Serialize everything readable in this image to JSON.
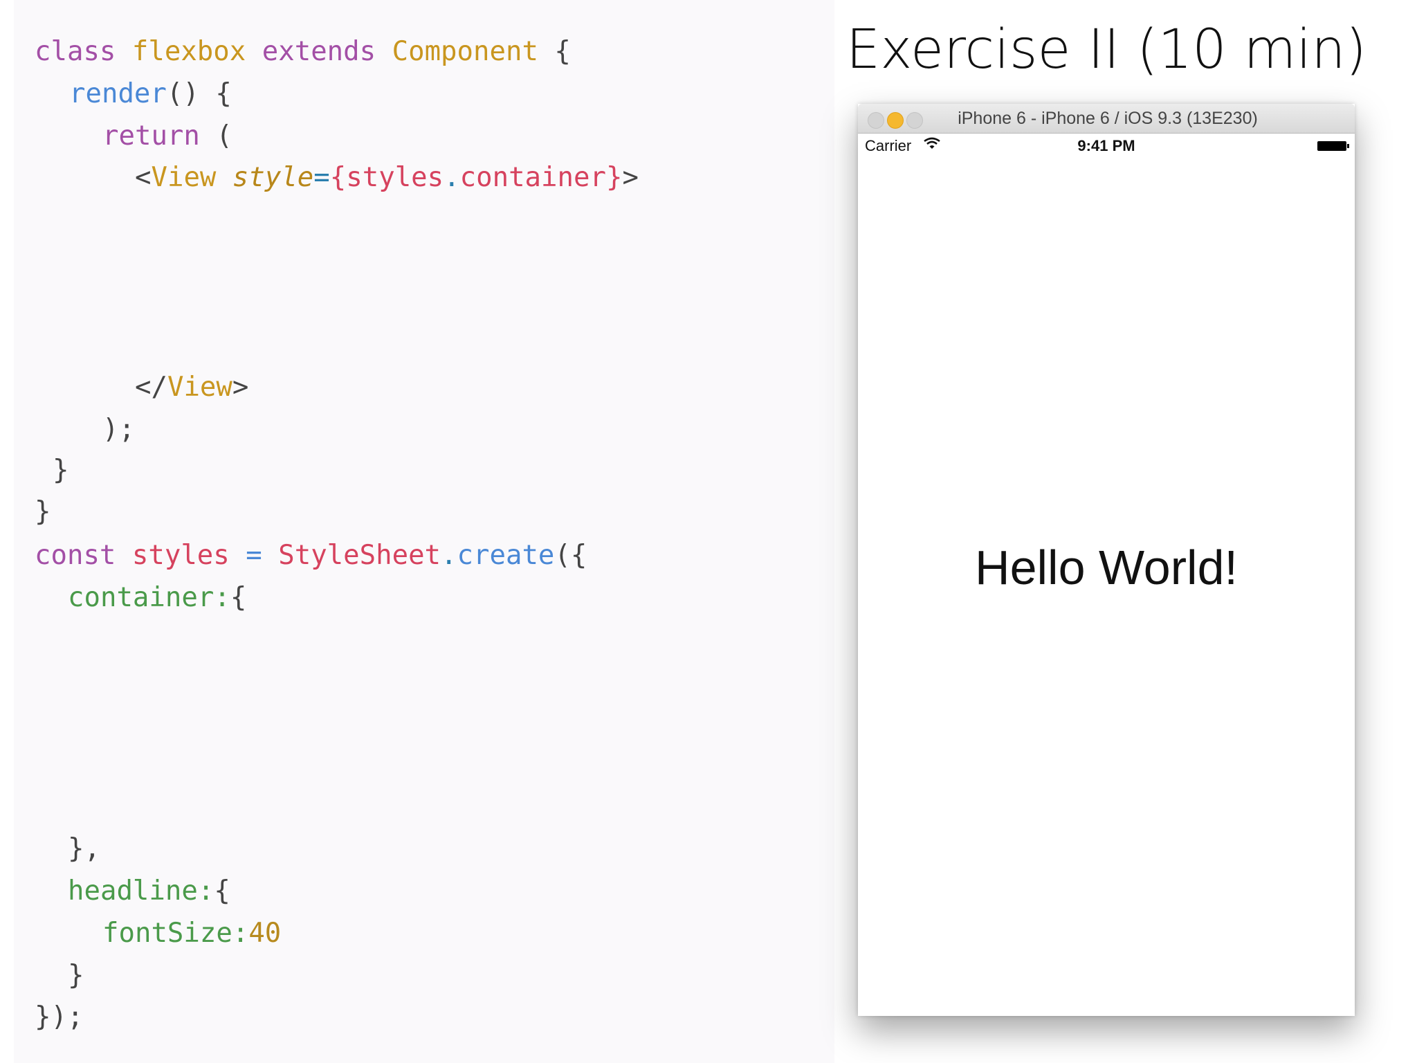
{
  "slide": {
    "title": "Exercise II (10 min)"
  },
  "code": {
    "line1": {
      "kw": "class",
      "name": "flexbox",
      "ext": "extends",
      "parent": "Component",
      "brace": "{"
    },
    "line2": {
      "fn": "render",
      "rest": "() {"
    },
    "line3": {
      "kw": "return",
      "rest": "("
    },
    "line4": {
      "lt": "<",
      "tag": "View",
      "attr": "style",
      "eq": "=",
      "ob": "{",
      "obj": "styles",
      "dot": ".",
      "prop": "container",
      "cb": "}",
      "gt": ">"
    },
    "line5": {
      "lt": "</",
      "tag": "View",
      "gt": ">"
    },
    "line6": {
      "text": ");"
    },
    "line7": {
      "text": "}"
    },
    "line8": {
      "text": "}"
    },
    "line9": {
      "kw": "const",
      "var": "styles",
      "eq": "=",
      "cls": "StyleSheet",
      "dot": ".",
      "fn": "create",
      "rest": "({"
    },
    "line10": {
      "prop": "container:",
      "rest": "{"
    },
    "line11": {
      "text": "},"
    },
    "line12": {
      "prop": "headline:",
      "rest": "{"
    },
    "line13": {
      "prop": "fontSize:",
      "num": "40"
    },
    "line14": {
      "text": "}"
    },
    "line15": {
      "text": "});"
    }
  },
  "simulator": {
    "window_title": "iPhone 6 - iPhone 6 / iOS 9.3 (13E230)",
    "status": {
      "carrier": "Carrier",
      "time": "9:41 PM"
    },
    "content": {
      "text": "Hello World!"
    },
    "icons": {
      "wifi": "wifi-icon",
      "battery": "battery-icon"
    }
  }
}
